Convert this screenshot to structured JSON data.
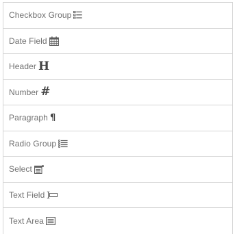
{
  "field_list": {
    "items": [
      {
        "label": "Checkbox Group",
        "icon": "checkbox-group-icon"
      },
      {
        "label": "Date Field",
        "icon": "calendar-icon"
      },
      {
        "label": "Header",
        "icon": "header-icon",
        "glyph": "H"
      },
      {
        "label": "Number",
        "icon": "number-icon",
        "glyph": "#"
      },
      {
        "label": "Paragraph",
        "icon": "paragraph-icon",
        "glyph": "¶"
      },
      {
        "label": "Radio Group",
        "icon": "radio-group-icon"
      },
      {
        "label": "Select",
        "icon": "select-icon"
      },
      {
        "label": "Text Field",
        "icon": "text-field-icon"
      },
      {
        "label": "Text Area",
        "icon": "text-area-icon"
      }
    ]
  },
  "colors": {
    "text": "#6f6f6f",
    "icon": "#5b5b5b",
    "border": "#d4d4d4",
    "background": "#ffffff"
  }
}
